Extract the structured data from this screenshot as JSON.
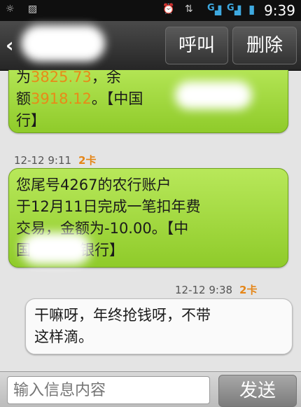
{
  "status_bar": {
    "time": "9:39",
    "signal_1": "G",
    "signal_2": "G",
    "icons": [
      "settings-icon",
      "image-icon",
      "alarm-icon",
      "sync-icon",
      "signal-icon",
      "battery-icon"
    ]
  },
  "header": {
    "back_icon": "chevron-left-icon",
    "call_label": "呼叫",
    "delete_label": "删除"
  },
  "messages": [
    {
      "direction": "incoming",
      "line1_prefix": "为",
      "line1_amount": "3825.73",
      "line1_suffix": "，余",
      "line2_prefix": "额",
      "line2_amount": "3918.12",
      "line2_suffix": "。【中国",
      "line3": "行】"
    },
    {
      "direction": "incoming",
      "time": "12-12 9:11",
      "sim": "2卡",
      "line1": "您尾号4267的农行账户",
      "line2": "于12月11日完成一笔扣年费",
      "line3": "交易，金额为-10.00。【中",
      "line4_prefix": "国",
      "line4_suffix": "银行】"
    },
    {
      "direction": "outgoing",
      "time": "12-12 9:38",
      "sim": "2卡",
      "line1": "干嘛呀，年终抢钱呀，不带",
      "line2": "这样滴。"
    }
  ],
  "composer": {
    "placeholder": "输入信息内容",
    "send_label": "发送"
  }
}
